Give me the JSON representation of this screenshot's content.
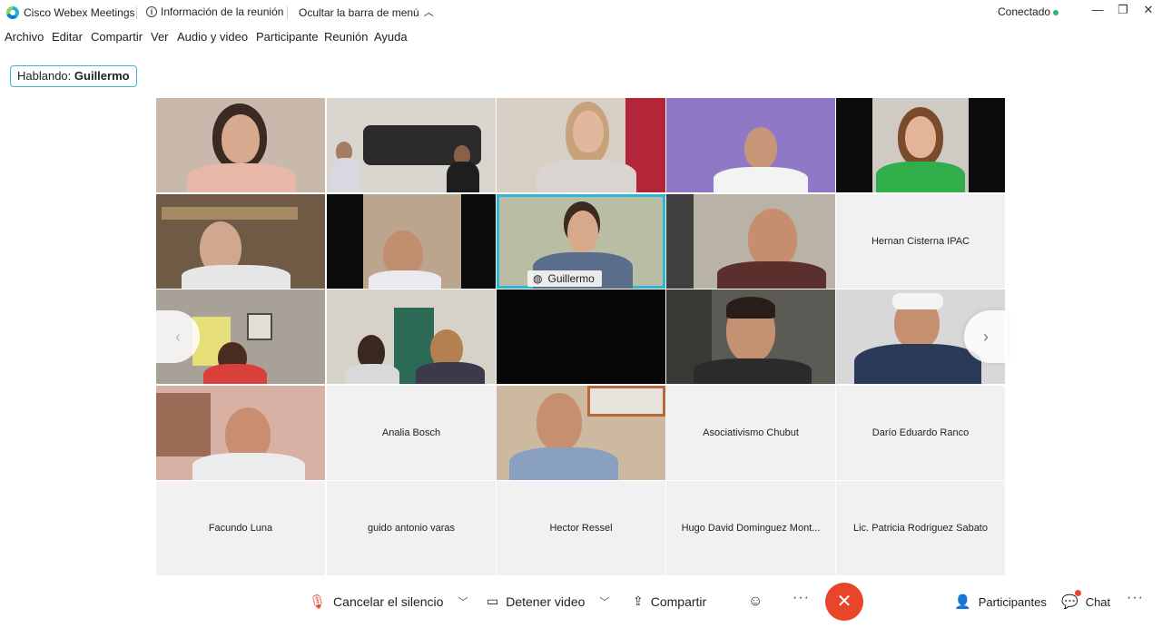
{
  "titlebar": {
    "app_title": "Cisco Webex Meetings",
    "meeting_info": "Información de la reunión",
    "hide_menu": "Ocultar la barra de menú",
    "status": "Conectado",
    "status_color": "#2fb36e",
    "minimize": "—",
    "restore": "❐",
    "close": "✕"
  },
  "menu": [
    "Archivo",
    "Editar",
    "Compartir",
    "Ver",
    "Audio y video",
    "Participante",
    "Reunión",
    "Ayuda"
  ],
  "speaking": {
    "label": "Hablando:",
    "name": "Guillermo"
  },
  "active_speaker": {
    "name": "Guillermo"
  },
  "tiles": {
    "hernan": "Hernan Cisterna IPAC",
    "analia": "Analia Bosch",
    "asociativismo": "Asociativismo Chubut",
    "dario": "Darío Eduardo Ranco",
    "facundo": "Facundo Luna",
    "guido": "guido antonio varas",
    "hector": "Hector Ressel",
    "hugo": "Hugo David Dominguez Mont...",
    "patricia": "Lic. Patricia Rodriguez Sabato"
  },
  "toolbar": {
    "unmute": "Cancelar el silencio",
    "stop_video": "Detener video",
    "share": "Compartir",
    "participants": "Participantes",
    "chat": "Chat",
    "end_color": "#e8452a"
  }
}
